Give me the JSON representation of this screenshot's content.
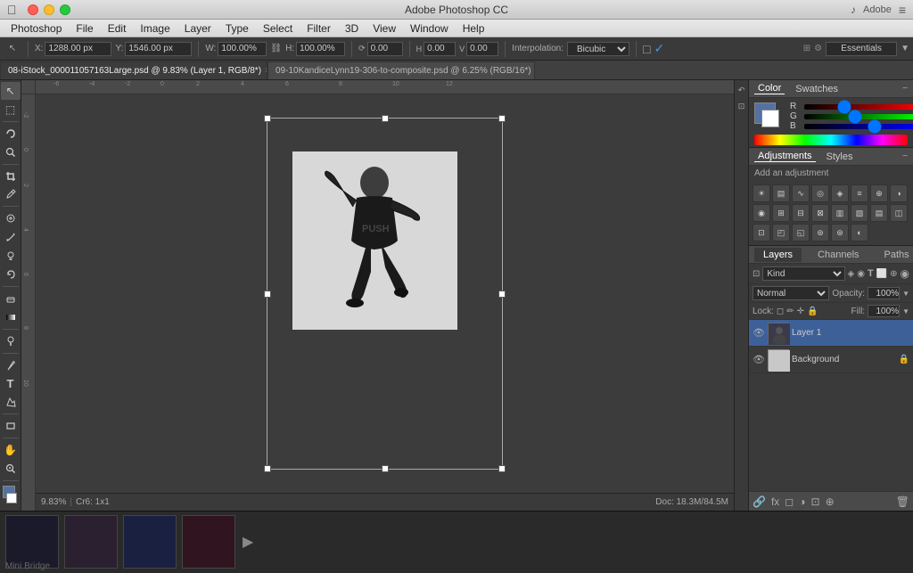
{
  "app": {
    "title": "Adobe Photoshop CC",
    "name": "Photoshop"
  },
  "traffic_lights": {
    "close": "×",
    "minimize": "−",
    "maximize": "+"
  },
  "menu": {
    "apple": "⌘",
    "items": [
      "Photoshop",
      "File",
      "Edit",
      "Image",
      "Layer",
      "Type",
      "Select",
      "Filter",
      "3D",
      "View",
      "Window",
      "Help"
    ]
  },
  "options_bar": {
    "x_label": "X:",
    "x_value": "1288.00 px",
    "y_label": "Y:",
    "y_value": "1546.00 px",
    "w_label": "W:",
    "w_value": "100.00%",
    "h_label": "H:",
    "h_value": "100.00%",
    "rotation_value": "0.00",
    "rotation_h_value": "0.00",
    "rotation_v_value": "0.00",
    "interp_label": "Interpolation:",
    "interp_value": "Bicubic",
    "essentials_label": "Essentials"
  },
  "tabs": [
    {
      "label": "08-iStock_000011057163Large.psd @ 9.83% (Layer 1, RGB/8*)",
      "active": true
    },
    {
      "label": "09-10KandiceLynn19-306-to-composite.psd @ 6.25% (RGB/16*)",
      "active": false
    }
  ],
  "tools": [
    {
      "name": "move-tool",
      "icon": "↖",
      "tooltip": "Move"
    },
    {
      "name": "marquee-tool",
      "icon": "⬚",
      "tooltip": "Marquee"
    },
    {
      "name": "lasso-tool",
      "icon": "⊙",
      "tooltip": "Lasso"
    },
    {
      "name": "quick-select-tool",
      "icon": "⚡",
      "tooltip": "Quick Select"
    },
    {
      "name": "crop-tool",
      "icon": "⊡",
      "tooltip": "Crop"
    },
    {
      "name": "eyedropper-tool",
      "icon": "✒",
      "tooltip": "Eyedropper"
    },
    {
      "name": "spot-heal-tool",
      "icon": "⊕",
      "tooltip": "Spot Heal"
    },
    {
      "name": "brush-tool",
      "icon": "✏",
      "tooltip": "Brush"
    },
    {
      "name": "clone-tool",
      "icon": "⊗",
      "tooltip": "Clone"
    },
    {
      "name": "history-brush-tool",
      "icon": "⟳",
      "tooltip": "History Brush"
    },
    {
      "name": "eraser-tool",
      "icon": "◻",
      "tooltip": "Eraser"
    },
    {
      "name": "gradient-tool",
      "icon": "▤",
      "tooltip": "Gradient"
    },
    {
      "name": "dodge-tool",
      "icon": "◑",
      "tooltip": "Dodge"
    },
    {
      "name": "pen-tool",
      "icon": "✒",
      "tooltip": "Pen"
    },
    {
      "name": "text-tool",
      "icon": "T",
      "tooltip": "Text"
    },
    {
      "name": "path-select-tool",
      "icon": "◈",
      "tooltip": "Path Select"
    },
    {
      "name": "rect-shape-tool",
      "icon": "⬜",
      "tooltip": "Rectangle"
    },
    {
      "name": "hand-tool",
      "icon": "✋",
      "tooltip": "Hand"
    },
    {
      "name": "zoom-tool",
      "icon": "⌕",
      "tooltip": "Zoom"
    }
  ],
  "fg_color": "#5272a1",
  "bg_color": "#ffffff",
  "color_panel": {
    "tabs": [
      "Color",
      "Swatches"
    ],
    "r_value": "83",
    "g_value": "110",
    "b_value": "161"
  },
  "adjustments_panel": {
    "title": "Adjustments",
    "tabs": [
      "Adjustments",
      "Styles"
    ],
    "add_adjustment_label": "Add an adjustment",
    "collapse": "−"
  },
  "layers_panel": {
    "tabs": [
      "Layers",
      "Channels",
      "Paths"
    ],
    "filter_kind": "Kind",
    "blend_mode": "Normal",
    "opacity_label": "Opacity:",
    "opacity_value": "100%",
    "fill_label": "Fill:",
    "fill_value": "100%",
    "lock_label": "Lock:",
    "layers": [
      {
        "name": "Layer 1",
        "type": "layer1",
        "visible": true,
        "active": true
      },
      {
        "name": "Background",
        "type": "bg",
        "visible": true,
        "active": false,
        "locked": true
      }
    ]
  },
  "status_bar": {
    "zoom": "9.83%",
    "extra": "Cr6: 1x1",
    "doc_info": "Doc: 18.3M/84.5M"
  },
  "mini_bridge": {
    "label": "Mini Bridge"
  },
  "canvas": {
    "transform_active": true
  }
}
